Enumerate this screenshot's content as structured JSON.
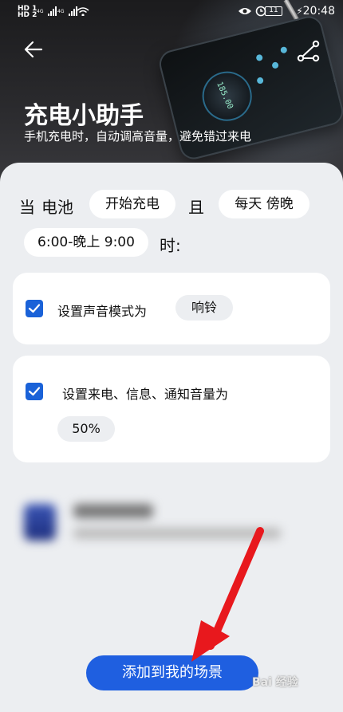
{
  "status": {
    "left_top": "HD 1",
    "left_bottom": "HD 2",
    "net1": "4G",
    "net2": "4G",
    "battery": "11",
    "time": "20:48"
  },
  "header": {
    "title": "充电小助手",
    "subtitle": "手机充电时，自动调高音量，避免错过来电",
    "hero_display": "185.00"
  },
  "condition": {
    "when": "当",
    "battery_label": "电池",
    "trigger": "开始充电",
    "and": "且",
    "schedule": "每天 傍晚",
    "time_range": "6:00-晚上 9:00",
    "colon": "时:"
  },
  "actions": [
    {
      "label": "设置声音模式为",
      "value": "响铃",
      "checked": true
    },
    {
      "label": "设置来电、信息、通知音量为",
      "value": "50%",
      "checked": true
    }
  ],
  "footer": {
    "add_button": "添加到我的场景",
    "watermark": "Bai 经验"
  },
  "colors": {
    "accent": "#1f5fe0",
    "checkbox": "#1a62d8",
    "arrow": "#e8181d"
  }
}
